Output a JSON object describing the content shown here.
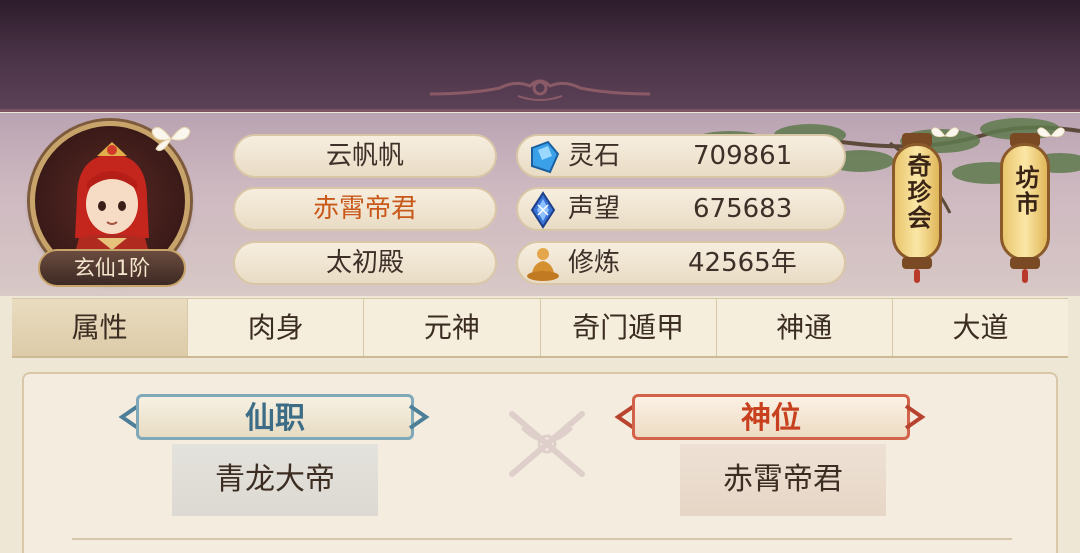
{
  "profile": {
    "rank_badge": "玄仙1阶",
    "name": "云帆帆",
    "title": "赤霄帝君",
    "palace": "太初殿"
  },
  "stats": [
    {
      "icon": "spirit-stone-icon",
      "label": "灵石",
      "value": "709861"
    },
    {
      "icon": "reputation-icon",
      "label": "声望",
      "value": "675683"
    },
    {
      "icon": "cultivation-icon",
      "label": "修炼",
      "value": "42565年"
    }
  ],
  "lanterns": [
    {
      "label": "奇珍会"
    },
    {
      "label": "坊市"
    }
  ],
  "tabs": [
    {
      "label": "属性",
      "active": true
    },
    {
      "label": "肉身",
      "active": false
    },
    {
      "label": "元神",
      "active": false
    },
    {
      "label": "奇门遁甲",
      "active": false
    },
    {
      "label": "神通",
      "active": false
    },
    {
      "label": "大道",
      "active": false
    }
  ],
  "attributes": {
    "immortal_post": {
      "header": "仙职",
      "value": "青龙大帝"
    },
    "divine_rank": {
      "header": "神位",
      "value": "赤霄帝君"
    }
  },
  "colors": {
    "title_orange": "#c8591a",
    "post_blue": "#3d6d86",
    "rank_red": "#c8411f"
  }
}
